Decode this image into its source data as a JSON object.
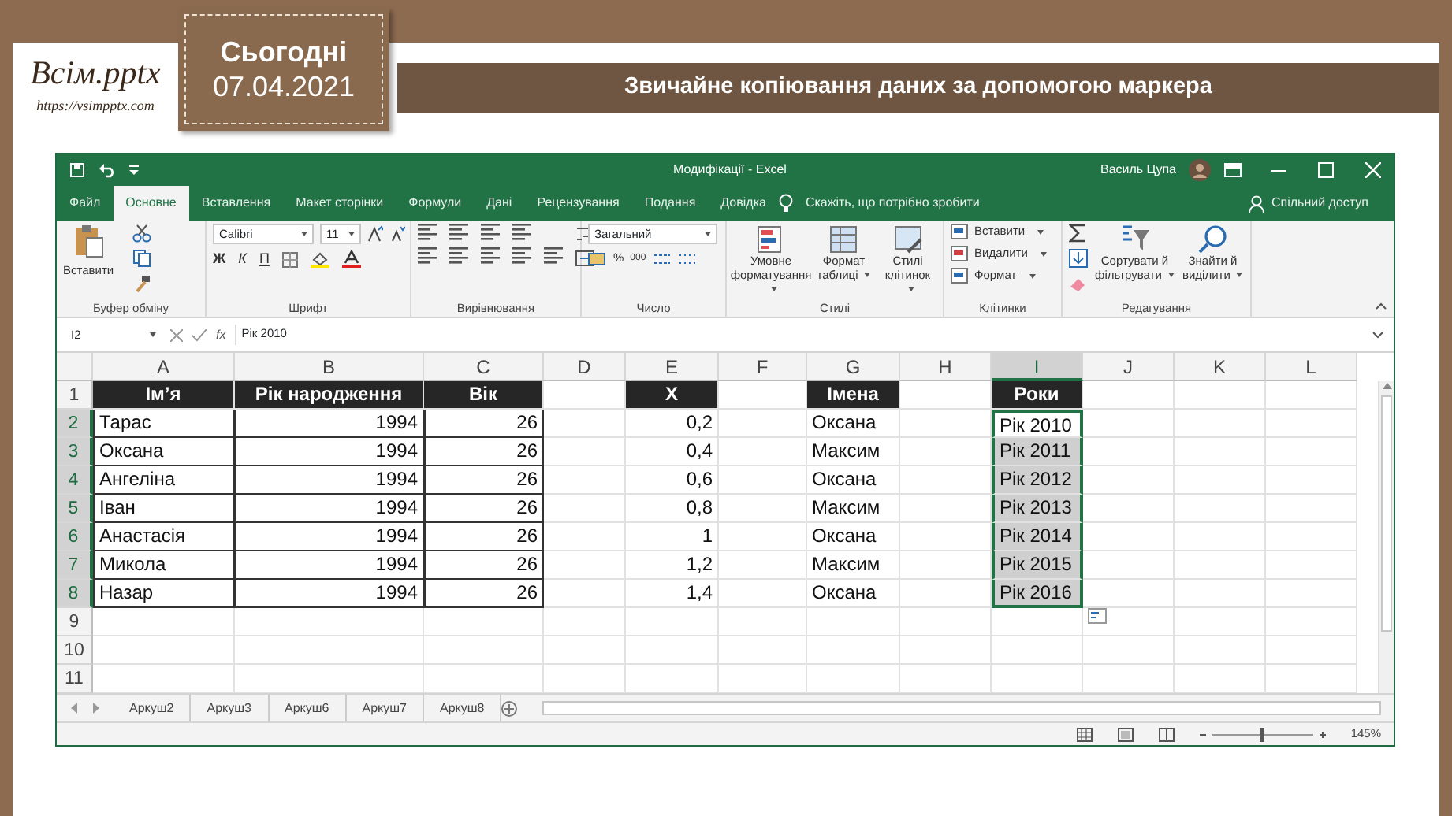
{
  "slide": {
    "logo_title": "Всім.pptx",
    "logo_url": "https://vsimpptx.com",
    "date_label": "Сьогодні",
    "date": "07.04.2021",
    "title": "Звичайне копіювання даних за допомогою маркера"
  },
  "excel": {
    "window_title": "Модифікації - Excel",
    "user": "Василь Цупа",
    "ribbon_tabs": [
      {
        "label": "Файл",
        "selected": false
      },
      {
        "label": "Основне",
        "selected": true
      },
      {
        "label": "Вставлення",
        "selected": false
      },
      {
        "label": "Макет сторінки",
        "selected": false
      },
      {
        "label": "Формули",
        "selected": false
      },
      {
        "label": "Дані",
        "selected": false
      },
      {
        "label": "Рецензування",
        "selected": false
      },
      {
        "label": "Подання",
        "selected": false
      },
      {
        "label": "Довідка",
        "selected": false
      }
    ],
    "tell_me": "Скажіть, що потрібно зробити",
    "share": "Спільний доступ",
    "ribbon_groups": [
      {
        "label": "Буфер обміну",
        "kind": "clipboard",
        "buttons": [
          "Вставити"
        ]
      },
      {
        "label": "Шрифт",
        "kind": "font",
        "font": "Calibri",
        "size": "11",
        "buttons": [
          "Ж",
          "К",
          "П"
        ]
      },
      {
        "label": "Вирівнювання",
        "kind": "alignment"
      },
      {
        "label": "Число",
        "kind": "number",
        "format": "Загальний",
        "buttons": [
          "%",
          "000"
        ]
      },
      {
        "label": "Стилі",
        "kind": "styles",
        "buttons": [
          "Умовне форматування",
          "Формат таблиці",
          "Стилі клітинок"
        ]
      },
      {
        "label": "Клітинки",
        "kind": "cells",
        "buttons": [
          "Вставити",
          "Видалити",
          "Формат"
        ]
      },
      {
        "label": "Редагування",
        "kind": "editing",
        "buttons": [
          "Сортувати й фільтрувати",
          "Знайти й виділити"
        ]
      }
    ],
    "name_box": "I2",
    "fx_label": "fx",
    "formula": "Рік 2010",
    "columns": [
      {
        "letter": "A",
        "kind": "text",
        "bordered": true,
        "selected": false
      },
      {
        "letter": "B",
        "kind": "number",
        "bordered": true,
        "selected": false
      },
      {
        "letter": "C",
        "kind": "number",
        "bordered": true,
        "selected": false
      },
      {
        "letter": "D",
        "kind": "text",
        "bordered": false,
        "selected": false
      },
      {
        "letter": "E",
        "kind": "number",
        "bordered": false,
        "selected": false
      },
      {
        "letter": "F",
        "kind": "text",
        "bordered": false,
        "selected": false
      },
      {
        "letter": "G",
        "kind": "text",
        "bordered": false,
        "selected": false
      },
      {
        "letter": "H",
        "kind": "text",
        "bordered": false,
        "selected": false
      },
      {
        "letter": "I",
        "kind": "text",
        "bordered": false,
        "selected": true
      },
      {
        "letter": "J",
        "kind": "text",
        "bordered": false,
        "selected": false
      },
      {
        "letter": "K",
        "kind": "text",
        "bordered": false,
        "selected": false
      },
      {
        "letter": "L",
        "kind": "text",
        "bordered": false,
        "selected": false
      }
    ],
    "rows": [
      {
        "number": "1",
        "kind": "header",
        "selected": false,
        "cells": {
          "A": "Ім’я",
          "B": "Рік народження",
          "C": "Вік",
          "E": "X",
          "G": "Імена",
          "I": "Роки"
        }
      },
      {
        "number": "2",
        "kind": "data",
        "selected": true,
        "cells": {
          "A": "Тарас",
          "B": "1994",
          "C": "26",
          "E": "0,2",
          "G": "Оксана",
          "I": "Рік 2010"
        }
      },
      {
        "number": "3",
        "kind": "data",
        "selected": true,
        "cells": {
          "A": "Оксана",
          "B": "1994",
          "C": "26",
          "E": "0,4",
          "G": "Максим",
          "I": "Рік 2011"
        }
      },
      {
        "number": "4",
        "kind": "data",
        "selected": true,
        "cells": {
          "A": "Ангеліна",
          "B": "1994",
          "C": "26",
          "E": "0,6",
          "G": "Оксана",
          "I": "Рік 2012"
        }
      },
      {
        "number": "5",
        "kind": "data",
        "selected": true,
        "cells": {
          "A": "Іван",
          "B": "1994",
          "C": "26",
          "E": "0,8",
          "G": "Максим",
          "I": "Рік 2013"
        }
      },
      {
        "number": "6",
        "kind": "data",
        "selected": true,
        "cells": {
          "A": "Анастасія",
          "B": "1994",
          "C": "26",
          "E": "1",
          "G": "Оксана",
          "I": "Рік 2014"
        }
      },
      {
        "number": "7",
        "kind": "data",
        "selected": true,
        "cells": {
          "A": "Микола",
          "B": "1994",
          "C": "26",
          "E": "1,2",
          "G": "Максим",
          "I": "Рік 2015"
        }
      },
      {
        "number": "8",
        "kind": "data",
        "selected": true,
        "cells": {
          "A": "Назар",
          "B": "1994",
          "C": "26",
          "E": "1,4",
          "G": "Оксана",
          "I": "Рік 2016"
        }
      },
      {
        "number": "9",
        "kind": "empty",
        "selected": false
      },
      {
        "number": "10",
        "kind": "empty",
        "selected": false
      },
      {
        "number": "11",
        "kind": "empty",
        "selected": false
      }
    ],
    "sheet_tabs": [
      {
        "label": "Аркуш2",
        "selected": false
      },
      {
        "label": "Аркуш3",
        "selected": false
      },
      {
        "label": "Аркуш6",
        "selected": false
      },
      {
        "label": "Аркуш7",
        "selected": false
      },
      {
        "label": "Аркуш8",
        "selected": false
      }
    ],
    "zoom": "145%"
  }
}
